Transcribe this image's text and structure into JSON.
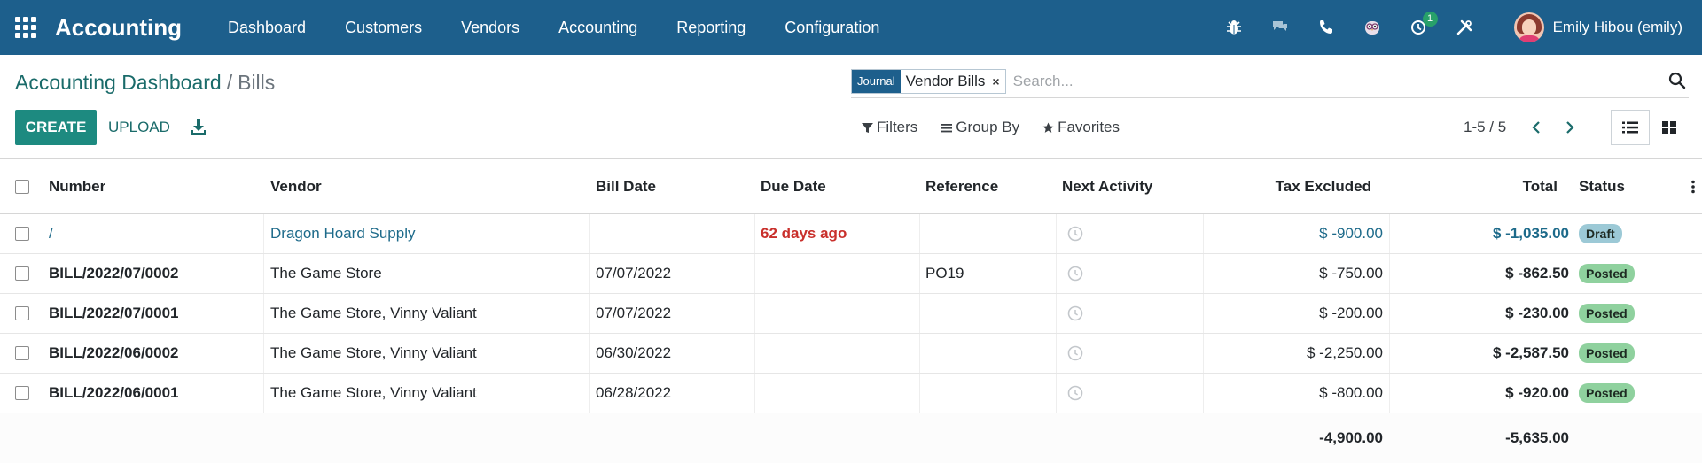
{
  "navbar": {
    "brand": "Accounting",
    "menu": [
      "Dashboard",
      "Customers",
      "Vendors",
      "Accounting",
      "Reporting",
      "Configuration"
    ],
    "activity_badge": "1",
    "user_name": "Emily Hibou (emily)",
    "color": "#1d5f8c"
  },
  "breadcrumb": {
    "parent": "Accounting Dashboard",
    "separator": "/",
    "current": "Bills"
  },
  "search": {
    "facet_label": "Journal",
    "facet_value": "Vendor Bills",
    "facet_remove": "×",
    "placeholder": "Search..."
  },
  "actions": {
    "create": "CREATE",
    "upload": "UPLOAD"
  },
  "filters": {
    "filters": "Filters",
    "group_by": "Group By",
    "favorites": "Favorites"
  },
  "pager": {
    "value": "1-5 / 5"
  },
  "table": {
    "headers": {
      "number": "Number",
      "vendor": "Vendor",
      "bill_date": "Bill Date",
      "due_date": "Due Date",
      "reference": "Reference",
      "next_activity": "Next Activity",
      "tax_excluded": "Tax Excluded",
      "total": "Total",
      "status": "Status"
    },
    "rows": [
      {
        "number": "/",
        "vendor": "Dragon Hoard Supply",
        "bill_date": "",
        "due_date": "62 days ago",
        "reference": "",
        "tax_excluded": "$ -900.00",
        "total": "$ -1,035.00",
        "status": "Draft"
      },
      {
        "number": "BILL/2022/07/0002",
        "vendor": "The Game Store",
        "bill_date": "07/07/2022",
        "due_date": "",
        "reference": "PO19",
        "tax_excluded": "$ -750.00",
        "total": "$ -862.50",
        "status": "Posted"
      },
      {
        "number": "BILL/2022/07/0001",
        "vendor": "The Game Store, Vinny Valiant",
        "bill_date": "07/07/2022",
        "due_date": "",
        "reference": "",
        "tax_excluded": "$ -200.00",
        "total": "$ -230.00",
        "status": "Posted"
      },
      {
        "number": "BILL/2022/06/0002",
        "vendor": "The Game Store, Vinny Valiant",
        "bill_date": "06/30/2022",
        "due_date": "",
        "reference": "",
        "tax_excluded": "$ -2,250.00",
        "total": "$ -2,587.50",
        "status": "Posted"
      },
      {
        "number": "BILL/2022/06/0001",
        "vendor": "The Game Store, Vinny Valiant",
        "bill_date": "06/28/2022",
        "due_date": "",
        "reference": "",
        "tax_excluded": "$ -800.00",
        "total": "$ -920.00",
        "status": "Posted"
      }
    ],
    "footer": {
      "tax_excluded": "-4,900.00",
      "total": "-5,635.00"
    }
  }
}
